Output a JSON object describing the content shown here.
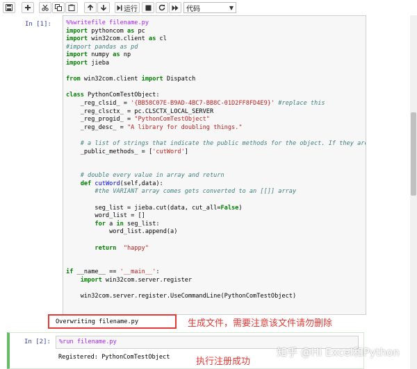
{
  "toolbar": {
    "run_label": "运行",
    "cell_type": "代码",
    "icons": [
      "save-icon",
      "plus-icon",
      "cut-icon",
      "copy-icon",
      "paste-icon",
      "arrow-up-icon",
      "arrow-down-icon",
      "run-icon",
      "stop-icon",
      "restart-icon",
      "fast-forward-icon"
    ]
  },
  "cell1": {
    "prompt": "In  [1]:",
    "code": [
      "%%writefile filename.py",
      "import pythoncom as pc",
      "import win32com.client as cl",
      "#import pandas as pd",
      "import numpy as np",
      "import jieba",
      "",
      "from win32com.client import Dispatch",
      "",
      "class PythonComTestObject:",
      "    _reg_clsid_ = '{BB58C07E-B9AD-4BC7-BB8C-01D2FF8FD4E9}' #replace this",
      "    _reg_clsctx_ = pc.CLSCTX_LOCAL_SERVER",
      "    _reg_progid_ = \"PythonComTestObject\"",
      "    _reg_desc_ = \"A library for doubling things.\"",
      "",
      "    # a list of strings that indicate the public methods for the object. If they aren't li",
      "    _public_methods_ = ['cutWord']",
      "",
      "",
      "    # double every value in array and return",
      "    def cutWord(self,data):",
      "        #the VARIANT array comes gets converted to an [[]] array",
      "",
      "        seg_list = jieba.cut(data, cut_all=False)",
      "        word_list = []",
      "        for a in seg_list:",
      "            word_list.append(a)",
      "",
      "        return  \"happy\"",
      "",
      "",
      "if __name__ == '__main__':",
      "    import win32com.server.register",
      "",
      "    win32com.server.register.UseCommandLine(PythonComTestObject)"
    ],
    "output": "Overwriting filename.py",
    "annotation": "生成文件，需要注意该文件请勿删除"
  },
  "cell2": {
    "prompt": "In  [2]:",
    "code": "%run filename.py",
    "output": "Registered: PythonComTestObject",
    "annotation": "执行注册成功"
  },
  "watermark": "知乎 @Hi Excel和Python",
  "colors": {
    "annotation": "#e53935",
    "prompt": "#303f9f",
    "active_cell": "#66bb6a"
  }
}
